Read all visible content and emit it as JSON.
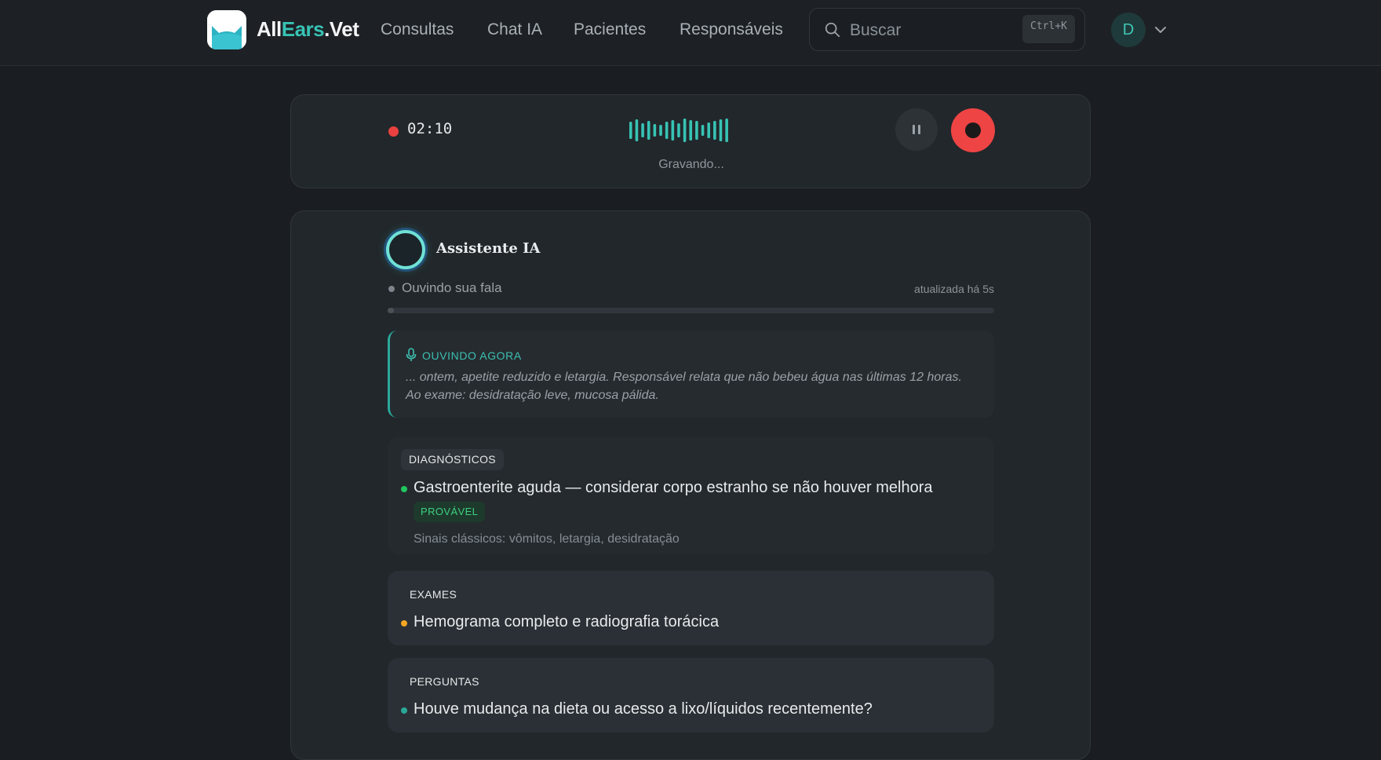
{
  "header": {
    "brand": {
      "part1": "All",
      "part2": "Ears",
      "part3": ".Vet"
    },
    "nav": [
      {
        "label": "Consultas"
      },
      {
        "label": "Chat IA"
      },
      {
        "label": "Pacientes"
      },
      {
        "label": "Responsáveis"
      }
    ],
    "search": {
      "placeholder": "Buscar",
      "shortcut": "Ctrl+K",
      "icon": "search-icon"
    },
    "user": {
      "initial": "D",
      "menu_icon": "chevron-down-icon"
    }
  },
  "recorder": {
    "time": "02:10",
    "status": "Gravando...",
    "waveform": [
      22,
      28,
      18,
      24,
      16,
      14,
      22,
      26,
      18,
      30,
      26,
      24,
      14,
      20,
      24,
      28,
      30
    ]
  },
  "assistant": {
    "title": "Assistente IA",
    "state_label": "Ouvindo sua fala",
    "updated": "atualizada há 5s",
    "progress": 0.01,
    "listening": {
      "heading": "OUVINDO AGORA",
      "text": "... ontem, apetite reduzido e letargia. Responsável relata que não bebeu água nas últimas 12 horas. Ao exame: desidratação leve, mucosa pálida."
    },
    "diagnoses": {
      "heading": "DIAGNÓSTICOS",
      "items": [
        {
          "text": "Gastroenterite aguda — considerar corpo estranho se não houver melhora",
          "badge": "PROVÁVEL",
          "detail": "Sinais clássicos: vômitos, letargia, desidratação"
        }
      ]
    },
    "exams": {
      "heading": "EXAMES",
      "items": [
        {
          "text": "Hemograma completo e radiografia torácica"
        }
      ]
    },
    "questions": {
      "heading": "PERGUNTAS",
      "items": [
        {
          "text": "Houve mudança na dieta ou acesso a lixo/líquidos recentemente?"
        }
      ]
    }
  },
  "colors": {
    "accent": "#37c3b4",
    "record": "#ef4444",
    "probable": "#3fcf80",
    "diagnosis_bullet": "#22c55e",
    "exam_bullet": "#f5a623",
    "question_bullet": "#2aa99b"
  }
}
